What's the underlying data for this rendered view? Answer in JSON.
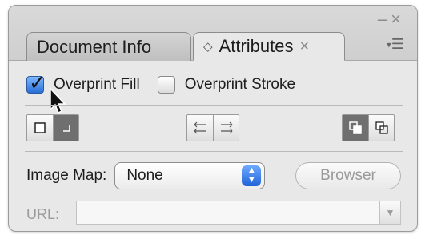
{
  "tabs": {
    "document_info": "Document Info",
    "attributes": "Attributes",
    "close_glyph": "×"
  },
  "window_controls": {
    "minimize": "–",
    "close": "×"
  },
  "panel_menu": "☰",
  "overprint": {
    "fill_label": "Overprint Fill",
    "fill_checked": true,
    "stroke_label": "Overprint Stroke",
    "stroke_checked": false
  },
  "toolbar": {
    "show_center": {
      "options": [
        "square-icon",
        "corner-icon"
      ],
      "active": 1
    },
    "direction": [
      "reverse-direction-icon",
      "forward-direction-icon"
    ],
    "fill_rule": {
      "options": [
        "nonzero-icon",
        "evenodd-icon"
      ],
      "active": 0
    }
  },
  "image_map": {
    "label": "Image Map:",
    "value": "None",
    "browser_label": "Browser"
  },
  "url": {
    "label": "URL:",
    "value": ""
  },
  "colors": {
    "checkbox_accent": "#2a6fd6",
    "select_accent": "#1f63d8",
    "active_toggle": "#6f6f6f"
  }
}
